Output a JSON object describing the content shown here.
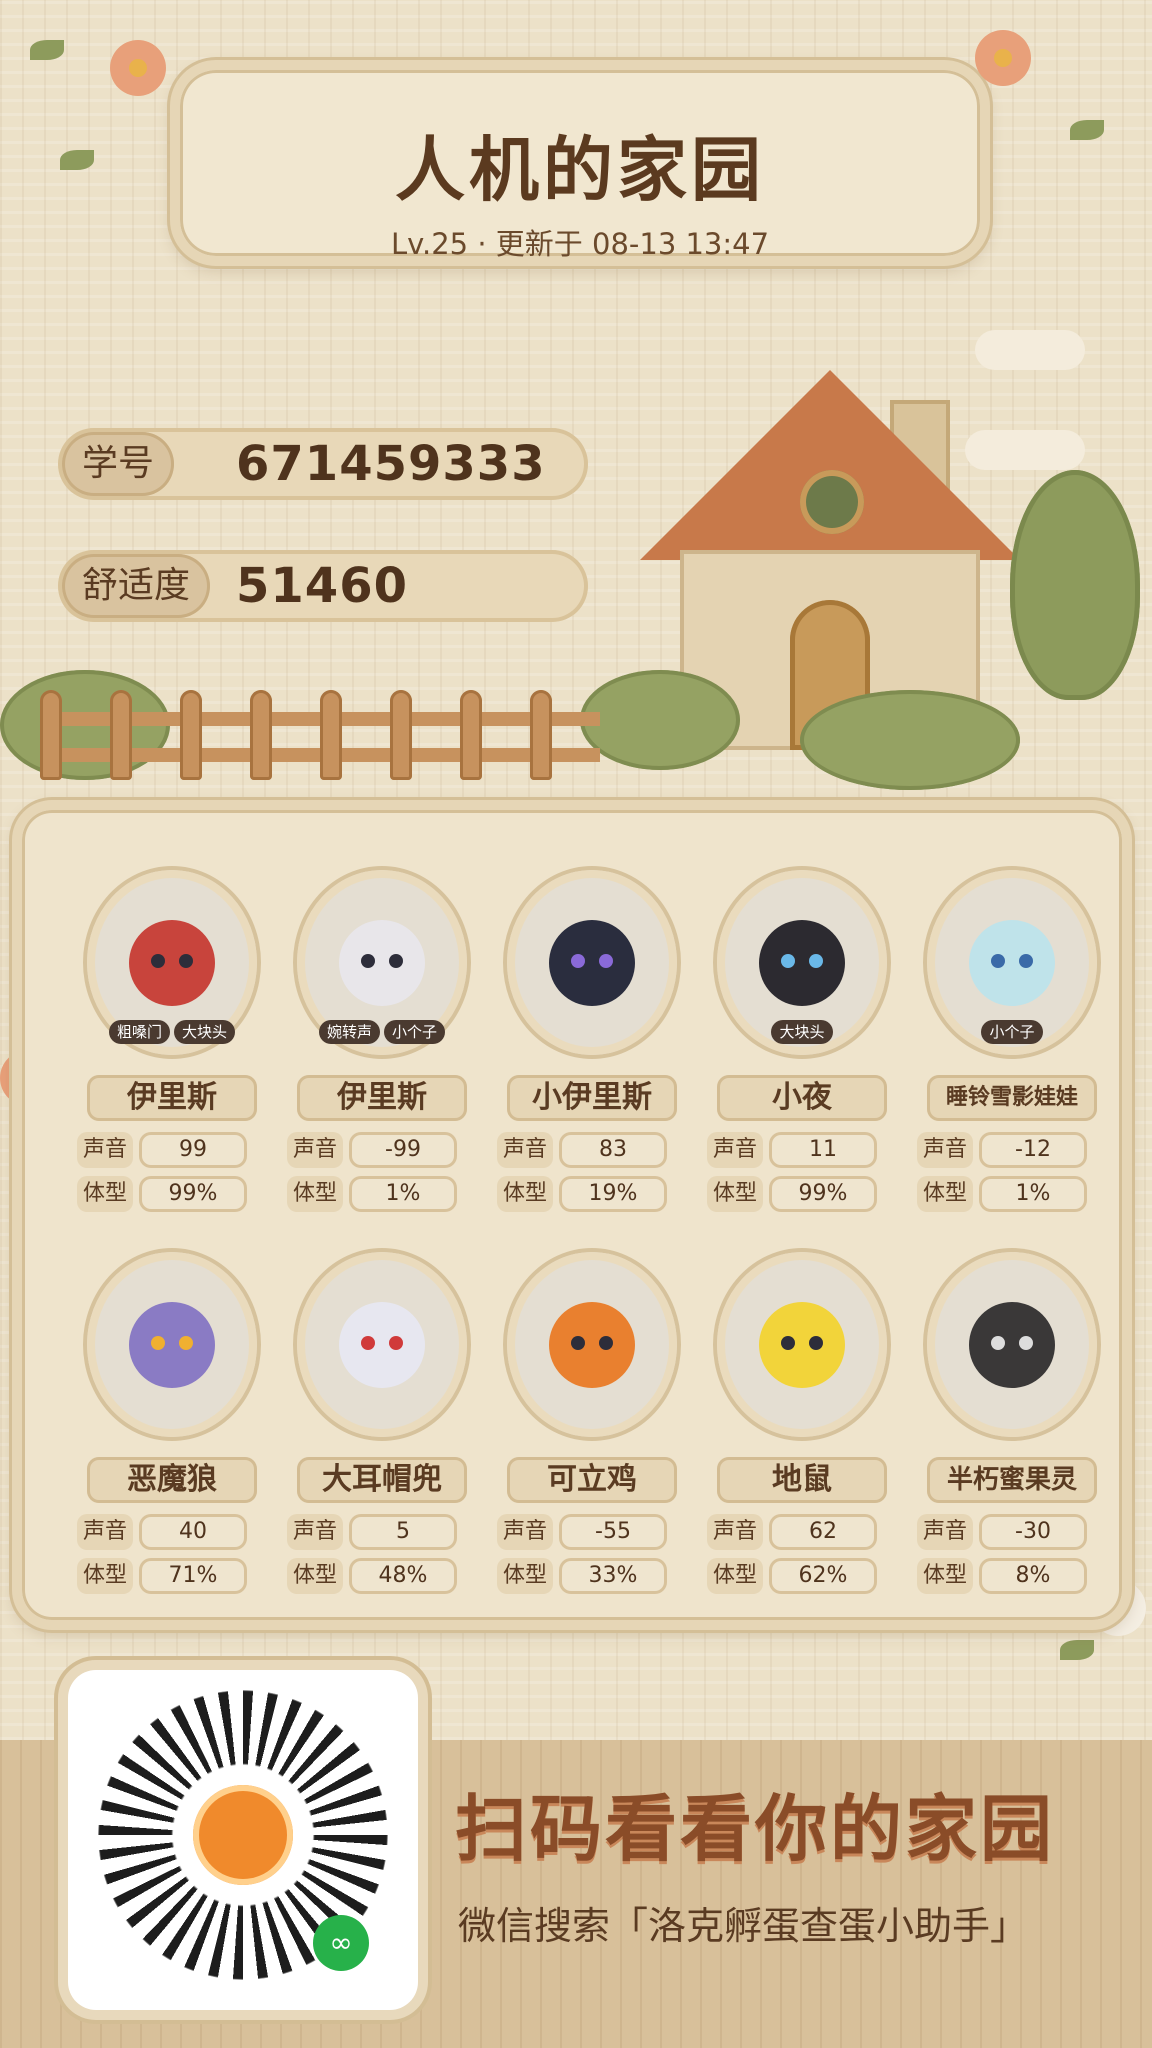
{
  "header": {
    "title": "人机的家园",
    "subtitle": "Lv.25 · 更新于 08-13 13:47"
  },
  "info": {
    "student_id_label": "学号",
    "student_id_value": "671459333",
    "comfort_label": "舒适度",
    "comfort_value": "51460"
  },
  "stat_labels": {
    "voice": "声音",
    "size": "体型"
  },
  "creatures": [
    {
      "name": "伊里斯",
      "tags": [
        "粗嗓门",
        "大块头"
      ],
      "voice": "99",
      "size": "99%",
      "color": "#c8443c"
    },
    {
      "name": "伊里斯",
      "tags": [
        "婉转声",
        "小个子"
      ],
      "voice": "-99",
      "size": "1%",
      "color": "#e8e6ea"
    },
    {
      "name": "小伊里斯",
      "tags": [],
      "voice": "83",
      "size": "19%",
      "color": "#2a2d3e"
    },
    {
      "name": "小夜",
      "tags": [
        "大块头"
      ],
      "voice": "11",
      "size": "99%",
      "color": "#2c2a30"
    },
    {
      "name": "睡铃雪影娃娃",
      "tags": [
        "小个子"
      ],
      "voice": "-12",
      "size": "1%",
      "color": "#bfe3ea"
    },
    {
      "name": "恶魔狼",
      "tags": [],
      "voice": "40",
      "size": "71%",
      "color": "#8a7bc4"
    },
    {
      "name": "大耳帽兜",
      "tags": [],
      "voice": "5",
      "size": "48%",
      "color": "#e7e7f0"
    },
    {
      "name": "可立鸡",
      "tags": [],
      "voice": "-55",
      "size": "33%",
      "color": "#e9802f"
    },
    {
      "name": "地鼠",
      "tags": [],
      "voice": "62",
      "size": "62%",
      "color": "#f2d43a"
    },
    {
      "name": "半朽蜜果灵",
      "tags": [],
      "voice": "-30",
      "size": "8%",
      "color": "#3a3838"
    }
  ],
  "footer": {
    "cta": "扫码看看你的家园",
    "hint": "微信搜索「洛克孵蛋查蛋小助手」"
  }
}
